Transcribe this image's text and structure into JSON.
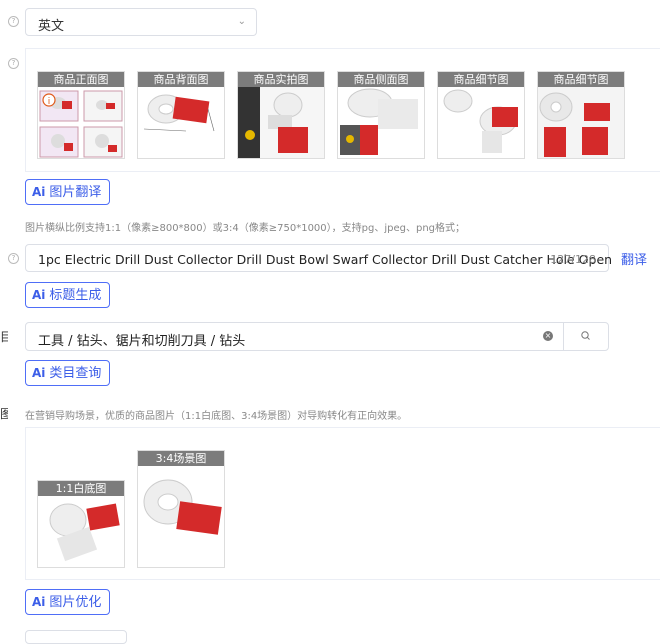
{
  "language": {
    "selected": "英文"
  },
  "images": {
    "thumbs": [
      {
        "label": "商品正面图"
      },
      {
        "label": "商品背面图"
      },
      {
        "label": "商品实拍图"
      },
      {
        "label": "商品侧面图"
      },
      {
        "label": "商品细节图"
      },
      {
        "label": "商品细节图"
      }
    ],
    "translate_button": "图片翻译",
    "hint": "图片横纵比例支持1:1（像素≥800*800）或3:4（像素≥750*1000），支持pg、jpeg、png格式；"
  },
  "title": {
    "value": "1pc Electric Drill Dust Collector Drill Dust Bowl Swarf Collector Drill Dust Catcher Hole Open",
    "count": "127/128",
    "translate_link": "翻译",
    "generate_button": "标题生成"
  },
  "category": {
    "left_label": "目",
    "value": "工具 / 钻头、锯片和切削刀具 / 钻头",
    "query_button": "类目查询"
  },
  "marketing": {
    "left_label": "图",
    "hint": "在营销导购场景，优质的商品图片（1:1白底图、3:4场景图）对导购转化有正向效果。",
    "thumbs": [
      {
        "label": "1:1白底图"
      },
      {
        "label": "3:4场景图"
      }
    ],
    "optimize_button": "图片优化"
  },
  "colors": {
    "accent": "#3c5ee8",
    "product_red": "#d42a2a"
  }
}
